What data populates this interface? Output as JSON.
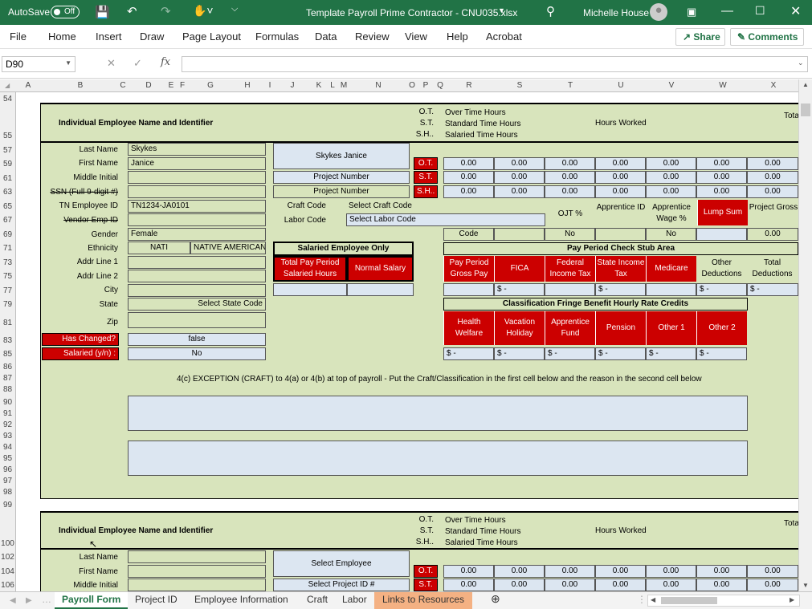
{
  "titlebar": {
    "autosave": "AutoSave",
    "autosave_state": "Off",
    "filename": "Template Payroll Prime Contractor - CNU035.xlsx",
    "user": "Michelle House"
  },
  "ribbon": {
    "tabs": [
      "File",
      "Home",
      "Insert",
      "Draw",
      "Page Layout",
      "Formulas",
      "Data",
      "Review",
      "View",
      "Help",
      "Acrobat"
    ],
    "share": "Share",
    "comments": "Comments"
  },
  "formula_bar": {
    "name_box": "D90",
    "fx": "fx",
    "value": ""
  },
  "columns": [
    "A",
    "B",
    "C",
    "D",
    "E",
    "F",
    "G",
    "H",
    "I",
    "J",
    "K",
    "L",
    "M",
    "N",
    "O",
    "P",
    "Q",
    "R",
    "S",
    "T",
    "U",
    "V",
    "W",
    "X"
  ],
  "rows": [
    "54",
    "55",
    "57",
    "59",
    "61",
    "63",
    "65",
    "67",
    "69",
    "71",
    "73",
    "75",
    "77",
    "79",
    "81",
    "83",
    "85",
    "86",
    "87",
    "88",
    "89",
    "90",
    "91",
    "92",
    "93",
    "94",
    "95",
    "96",
    "97",
    "98",
    "99",
    "100",
    "102",
    "104",
    "106"
  ],
  "block1": {
    "header_title": "Individual Employee Name and Identifier",
    "hours_codes": [
      "O.T.",
      "S.T.",
      "S.H.."
    ],
    "hours_desc": [
      "Over Time Hours",
      "Standard Time Hours",
      "Salaried Time Hours"
    ],
    "hours_worked": "Hours Worked",
    "total_partial": "Tota",
    "labels": [
      "Last Name",
      "First Name",
      "Middle Initial",
      "SSN (Full 9-digit #)",
      "TN Employee ID",
      "Vendor Emp ID",
      "Gender",
      "Ethnicity",
      "Addr Line 1",
      "Addr Line 2",
      "City",
      "State",
      "Zip"
    ],
    "values": {
      "last_name": "Skykes",
      "first_name": "Janice",
      "middle_initial": "",
      "ssn": "",
      "tn_employee_id": "TN1234-JA0101",
      "vendor_emp_id": "",
      "gender": "Female",
      "ethnicity_code": "NATI",
      "ethnicity_name": "NATIVE AMERICAN",
      "addr1": "",
      "addr2": "",
      "city": "",
      "state": "Select State Code",
      "zip": ""
    },
    "has_changed_label": "Has Changed?",
    "has_changed": "false",
    "salaried_label": "Salaried (y/n) :",
    "salaried": "No",
    "employee_display": "Skykes Janice",
    "project_number_1": "Project Number",
    "project_number_2": "Project Number",
    "craft_code_label": "Craft Code",
    "craft_code": "Select Craft Code",
    "labor_code_label": "Labor Code",
    "labor_code": "Select Labor Code",
    "hour_rows": [
      [
        "0.00",
        "0.00",
        "0.00",
        "0.00",
        "0.00",
        "0.00",
        "0.00"
      ],
      [
        "0.00",
        "0.00",
        "0.00",
        "0.00",
        "0.00",
        "0.00",
        "0.00"
      ],
      [
        "0.00",
        "0.00",
        "0.00",
        "0.00",
        "0.00",
        "0.00",
        "0.00"
      ]
    ],
    "ojt": "OJT %",
    "apprentice_id": "Apprentice ID",
    "apprentice_wage": "Apprentice Wage %",
    "lump_sum": "Lump Sum",
    "project_gross": "Project Gross",
    "code_label": "Code",
    "ojt_value": "No",
    "wage_value": "No",
    "gross_value": "0.00",
    "salaried_only": "Salaried Employee Only",
    "total_pay_period": "Total Pay Period Salaried Hours",
    "normal_salary": "Normal Salary",
    "stub_area": "Pay Period Check Stub Area",
    "stub_headers": [
      "Pay Period Gross Pay",
      "FICA",
      "Federal Income Tax",
      "State Income Tax",
      "Medicare",
      "Other Deductions",
      "Total Deductions"
    ],
    "stub_values": [
      "",
      "$      -",
      "",
      "$      -",
      "",
      "$      -",
      "$      -"
    ],
    "fringe_title": "Classification Fringe Benefit Hourly Rate Credits",
    "fringe_headers": [
      "Health Welfare",
      "Vacation Holiday",
      "Apprentice Fund",
      "Pension",
      "Other 1",
      "Other 2"
    ],
    "fringe_values": [
      "$      -",
      "$      -",
      "$      -",
      "$      -",
      "$      -",
      "$      -"
    ],
    "exception_text": "4(c) EXCEPTION (CRAFT) to 4(a) or 4(b) at top of payroll - Put the Craft/Classification in the first cell below and the reason in the second cell below"
  },
  "block2": {
    "header_title": "Individual Employee Name and Identifier",
    "hours_codes": [
      "O.T.",
      "S.T.",
      "S.H.."
    ],
    "hours_desc": [
      "Over Time Hours",
      "Standard Time Hours",
      "Salaried Time Hours"
    ],
    "hours_worked": "Hours Worked",
    "total_partial": "Tota",
    "labels": [
      "Last Name",
      "First Name",
      "Middle Initial"
    ],
    "select_employee": "Select Employee",
    "select_project": "Select Project ID #",
    "hour_rows": [
      [
        "0.00",
        "0.00",
        "0.00",
        "0.00",
        "0.00",
        "0.00",
        "0.00"
      ],
      [
        "0.00",
        "0.00",
        "0.00",
        "0.00",
        "0.00",
        "0.00",
        "0.00"
      ]
    ]
  },
  "sheet_tabs": [
    "Payroll Form",
    "Project ID",
    "Employee Information",
    "Craft",
    "Labor",
    "Links to Resources"
  ],
  "active_tab": "Payroll Form"
}
